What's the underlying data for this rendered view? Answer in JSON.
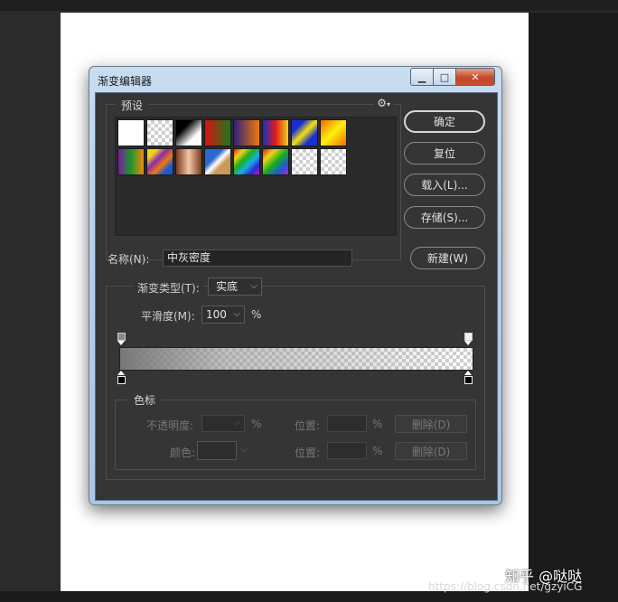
{
  "dialog": {
    "title": "渐变编辑器",
    "window_buttons": {
      "minimize": "▁",
      "maximize": "□",
      "close": "✕"
    }
  },
  "presets": {
    "label": "预设",
    "gear_icon": "gear-icon",
    "swatches": [
      {
        "name": "foreground-to-background",
        "css": "linear-gradient(90deg,#ffffff,#ffffff)"
      },
      {
        "name": "foreground-to-transparent",
        "css": "checker"
      },
      {
        "name": "black-white",
        "css": "linear-gradient(135deg,#000 30%,#fff 70%)"
      },
      {
        "name": "red-green",
        "css": "linear-gradient(90deg,#d11 0%,#1a7a1a 100%)"
      },
      {
        "name": "violet-orange",
        "css": "linear-gradient(90deg,#30207a,#f0780a)"
      },
      {
        "name": "blue-red-yellow",
        "css": "linear-gradient(90deg,#1330c8,#e11a1a,#f2d21a)"
      },
      {
        "name": "blue-yellow-blue",
        "css": "linear-gradient(135deg,#1a2fd0 25%,#f6e20a 50%,#1a2fd0 75%)"
      },
      {
        "name": "orange-yellow-orange",
        "css": "linear-gradient(135deg,#f26a0a,#fff10a,#f26a0a)"
      },
      {
        "name": "violet-green-orange",
        "css": "linear-gradient(90deg,#7a1aa0,#1a9a2a,#f08a0a)"
      },
      {
        "name": "yellow-violet-orange-blue",
        "css": "linear-gradient(135deg,#f2d21a 20%,#8a2ab0 40%,#f07a0a 60%,#1a5ad0 80%)"
      },
      {
        "name": "copper",
        "css": "linear-gradient(90deg,#7a3a1a,#f2c8a8,#7a3a1a)"
      },
      {
        "name": "chrome",
        "css": "linear-gradient(135deg,#2a6ad0 35%,#ffffff 50%,#c89a5a 65%)"
      },
      {
        "name": "spectrum",
        "css": "linear-gradient(135deg,#e11a1a,#f2d21a,#1ab01a,#1ab0e0,#2a2ad0,#c01ad0)"
      },
      {
        "name": "transparent-rainbow",
        "css": "linear-gradient(135deg,#e11a1a,#f2d21a,#1ab01a,#1a5ad0,#c01ad0)"
      },
      {
        "name": "transparent-stripes",
        "css": "checker"
      },
      {
        "name": "neutral-density",
        "css": "checker"
      }
    ]
  },
  "buttons": {
    "ok": "确定",
    "reset": "复位",
    "load": "载入(L)...",
    "save": "存储(S)...",
    "new": "新建(W)"
  },
  "name_field": {
    "label": "名称(N):",
    "value": "中灰密度"
  },
  "gradient_type": {
    "label": "渐变类型(T):",
    "selected": "实底"
  },
  "smoothness": {
    "label": "平滑度(M):",
    "value": "100",
    "unit": "%"
  },
  "color_stops": {
    "legend": "色标",
    "opacity_label": "不透明度:",
    "opacity_unit": "%",
    "location_label_1": "位置:",
    "location_unit_1": "%",
    "delete_label_1": "删除(D)",
    "color_label": "颜色:",
    "location_label_2": "位置:",
    "location_unit_2": "%",
    "delete_label_2": "删除(D)"
  },
  "watermark": {
    "line1": "知乎 @哒哒",
    "line2": "https://blog.csdn.net/gzyiCG"
  },
  "colors": {
    "dialog_bg": "#353535",
    "title_frame": "#b7d0ea",
    "close_red": "#c4482a"
  }
}
